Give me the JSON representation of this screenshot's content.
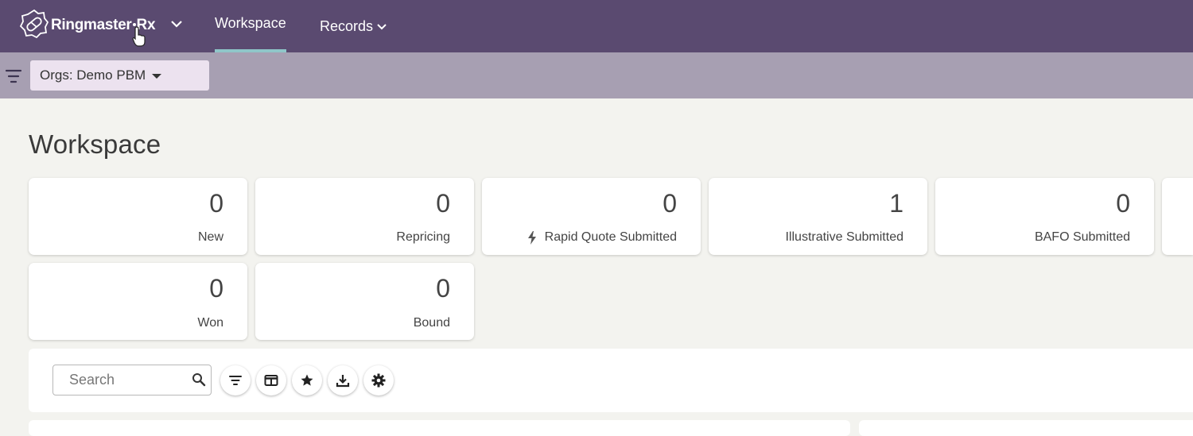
{
  "nav": {
    "brand": "Ringmaster",
    "brand_suffix": "Rx",
    "items": [
      {
        "label": "Workspace",
        "active": true
      },
      {
        "label": "Records",
        "has_dropdown": true
      }
    ]
  },
  "filters": {
    "org_select_label": "Orgs: Demo PBM"
  },
  "page": {
    "title": "Workspace"
  },
  "cards": [
    {
      "count": "0",
      "label": "New"
    },
    {
      "count": "0",
      "label": "Repricing"
    },
    {
      "count": "0",
      "label": "Rapid Quote Submitted",
      "icon": "lightning-icon"
    },
    {
      "count": "1",
      "label": "Illustrative Submitted"
    },
    {
      "count": "0",
      "label": "BAFO Submitted"
    },
    {
      "count": "0",
      "label": "Won"
    },
    {
      "count": "0",
      "label": "Bound"
    }
  ],
  "toolbar": {
    "search_placeholder": "Search",
    "buttons": [
      "filter-icon",
      "columns-icon",
      "star-icon",
      "download-icon",
      "gear-icon"
    ]
  },
  "colors": {
    "topnav": "#5a4a70",
    "filterbar": "#a79fb2",
    "accent_underline": "#8fc6c9",
    "org_select_bg": "#ece2ef",
    "page_bg": "#f3f3ef"
  }
}
